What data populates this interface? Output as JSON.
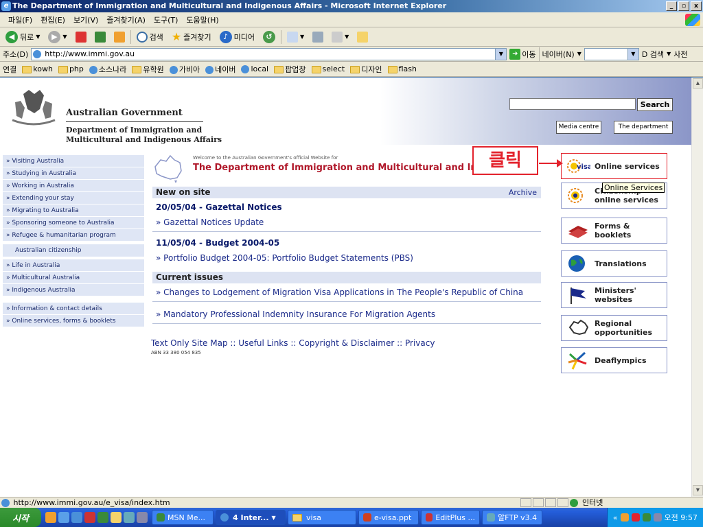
{
  "window": {
    "title": "The Department of Immigration and Multicultural and Indigenous Affairs - Microsoft Internet Explorer",
    "min_label": "_",
    "max_label": "▫",
    "close_label": "x"
  },
  "menubar": [
    "파일(F)",
    "편집(E)",
    "보기(V)",
    "즐겨찾기(A)",
    "도구(T)",
    "도움말(H)"
  ],
  "toolbar": {
    "back_label": "뒤로",
    "search_label": "검색",
    "favorites_label": "즐겨찾기",
    "media_label": "미디어"
  },
  "address": {
    "label": "주소(D)",
    "url": "http://www.immi.gov.au",
    "go_label": "이동",
    "naver_label": "네이버(N)",
    "search_label": "D 검색",
    "dict_label": "사전"
  },
  "links": {
    "label": "연결",
    "items": [
      "kowh",
      "php",
      "소스나라",
      "유학원",
      "가비아",
      "네이버",
      "local",
      "팝업창",
      "select",
      "디자인",
      "flash"
    ]
  },
  "page": {
    "gov_name": "Australian Government",
    "dept_name_1": "Department of Immigration and",
    "dept_name_2": "Multicultural and Indigenous Affairs",
    "search_button": "Search",
    "media_centre": "Media centre",
    "the_department": "The department",
    "nav_group_1": [
      "Visiting Australia",
      "Studying in Australia",
      "Working in Australia",
      "Extending your stay",
      "Migrating to Australia",
      "Sponsoring someone to Australia",
      "Refugee & humanitarian program"
    ],
    "nav_citizenship": "Australian citizenship",
    "nav_group_2": [
      "Life in Australia",
      "Multicultural Australia",
      "Indigenous Australia"
    ],
    "nav_group_3": [
      "Information & contact details",
      "Online services, forms & booklets"
    ],
    "welcome_small": "Welcome to the Australian Government's official Website for",
    "welcome_big": "The Department of Immigration and Multicultural and Indig",
    "new_on_site": "New on site",
    "archive": "Archive",
    "news": [
      {
        "date": "20/05/04 - Gazettal Notices",
        "link": "Gazettal Notices Update"
      },
      {
        "date": "11/05/04 - Budget 2004-05",
        "link": "Portfolio Budget 2004-05: Portfolio Budget Statements (PBS)"
      }
    ],
    "current_issues": "Current issues",
    "issues": [
      "Changes to Lodgement of Migration Visa Applications in The People's Republic of China",
      "Mandatory Professional Indemnity Insurance For Migration Agents"
    ],
    "footer_links": "Text Only Site Map :: Useful Links :: Copyright & Disclaimer :: Privacy",
    "abn": "ABN 33 380 054 835",
    "callout": "클릭",
    "tooltip": "Online Services",
    "services": [
      {
        "label1": "Online services",
        "label2": "",
        "icon": "evisa-icon"
      },
      {
        "label1": "Citizenship",
        "label2": "online services",
        "icon": "citizenship-icon"
      },
      {
        "label1": "Forms &",
        "label2": "booklets",
        "icon": "forms-icon"
      },
      {
        "label1": "Translations",
        "label2": "",
        "icon": "globe-icon"
      },
      {
        "label1": "Ministers'",
        "label2": "websites",
        "icon": "flag-icon"
      },
      {
        "label1": "Regional",
        "label2": "opportunities",
        "icon": "map-icon"
      },
      {
        "label1": "Deaflympics",
        "label2": "",
        "icon": "deaflympics-icon"
      }
    ],
    "bullet": "»"
  },
  "statusbar": {
    "url": "http://www.immi.gov.au/e_visa/index.htm",
    "zone": "인터넷"
  },
  "taskbar": {
    "start": "시작",
    "tasks": [
      "MSN Me...",
      "4 Inter...",
      "visa",
      "e-visa.ppt",
      "EditPlus ...",
      "알FTP v3.4"
    ],
    "clock": "오전 9:57"
  },
  "colors": {
    "accent_red": "#e3222c",
    "nav_bg": "#dfe6f5",
    "heading_red": "#b0182a"
  }
}
